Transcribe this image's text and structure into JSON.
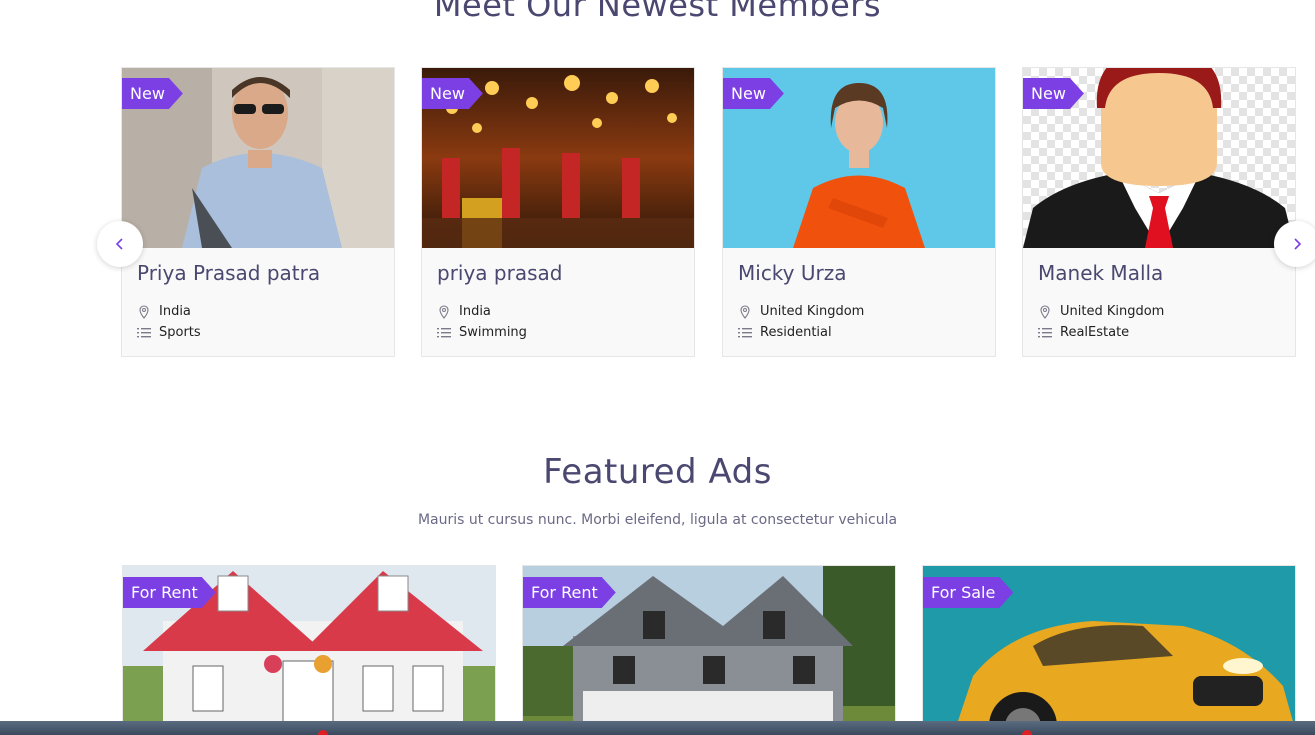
{
  "members_section": {
    "title": "Meet Our Newest Members",
    "prev_icon": "chevron-left-icon",
    "next_icon": "chevron-right-icon",
    "members": [
      {
        "badge": "New",
        "name": "Priya Prasad patra",
        "location": "India",
        "category": "Sports"
      },
      {
        "badge": "New",
        "name": "priya prasad",
        "location": "India",
        "category": "Swimming"
      },
      {
        "badge": "New",
        "name": "Micky Urza",
        "location": "United Kingdom",
        "category": "Residential"
      },
      {
        "badge": "New",
        "name": "Manek Malla",
        "location": "United Kingdom",
        "category": "RealEstate"
      }
    ]
  },
  "ads_section": {
    "title": "Featured Ads",
    "subtitle": "Mauris ut cursus nunc. Morbi eleifend, ligula at consectetur vehicula",
    "ads": [
      {
        "badge": "For Rent"
      },
      {
        "badge": "For Rent"
      },
      {
        "badge": "For Sale"
      }
    ]
  },
  "colors": {
    "accent": "#7b3fe4",
    "title": "#4a4870",
    "card_bg": "#f9f9f9"
  },
  "icons": {
    "location": "map-pin-icon",
    "category": "list-icon"
  }
}
